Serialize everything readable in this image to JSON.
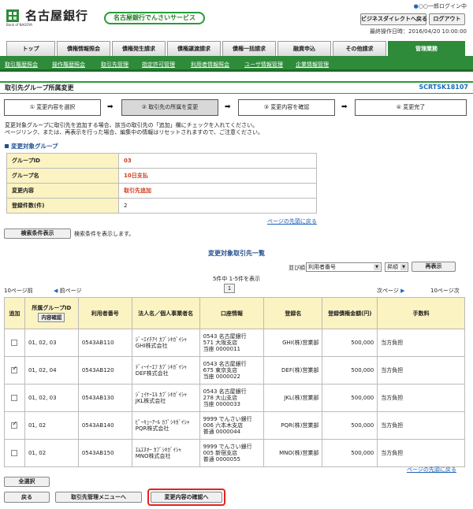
{
  "header": {
    "bank_name": "名古屋銀行",
    "bank_en": "Bank of NAGOYA",
    "service_badge": "名古屋銀行でんさいサービス",
    "user_name": "○○一郎ログイン中",
    "last_login": "最終操作日時：2016/04/20 10:00:00",
    "business_direct_button": "ビジネスダイレクトへ戻る",
    "logout_button": "ログアウト"
  },
  "tabs": [
    {
      "label": "トップ",
      "active": false
    },
    {
      "label": "債権情報照会",
      "active": false
    },
    {
      "label": "債権発生請求",
      "active": false
    },
    {
      "label": "債権譲渡請求",
      "active": false
    },
    {
      "label": "債権一括請求",
      "active": false
    },
    {
      "label": "融資申込",
      "active": false
    },
    {
      "label": "その他請求",
      "active": false
    },
    {
      "label": "管理業務",
      "active": true
    }
  ],
  "subnav": [
    "取引履歴照会",
    "操作履歴照会",
    "取引先管理",
    "指定許可管理",
    "利用者情報照会",
    "ユーザ情報管理",
    "企業情報管理"
  ],
  "page": {
    "title": "取引先グループ所属変更",
    "code": "SCRTSK18107"
  },
  "steps": [
    {
      "label": "① 変更内容を選択",
      "active": false
    },
    {
      "label": "② 取引先の所属を変更",
      "active": true
    },
    {
      "label": "③ 変更内容を確認",
      "active": false
    },
    {
      "label": "④ 変更完了",
      "active": false
    }
  ],
  "description": [
    "変更対象グループに取引先を追加する場合、該当の取引先の「追加」欄にチェックを入れてください。",
    "ページリンク、または、再表示を行った場合、編集中の情報はリセットされますので、ご注意ください。"
  ],
  "group_section": {
    "title": "変更対象グループ",
    "rows": [
      {
        "key": "グループID",
        "value": "03",
        "red": true
      },
      {
        "key": "グループ名",
        "value": "10日支払",
        "red": true
      },
      {
        "key": "変更内容",
        "value": "取引先追加",
        "red": true
      },
      {
        "key": "登録件数(件)",
        "value": "2",
        "red": false
      }
    ]
  },
  "page_top_link": "ページの先頭に戻る",
  "search": {
    "button": "検索条件表示",
    "text": "検索条件を表示します。"
  },
  "list": {
    "title": "変更対象取引先一覧",
    "sort_label": "並び順:",
    "sort_value": "利用者番号",
    "order_value": "昇順",
    "redisplay_button": "再表示",
    "count_text": "5件中 1-5件を表示",
    "page_number": "1",
    "prev10": "10ページ前",
    "prev": "前ページ",
    "next": "次ページ",
    "next10": "10ページ次",
    "headers": {
      "add": "追加",
      "group_id": "所属グループID",
      "content_confirm": "内容確認",
      "user_no": "利用者番号",
      "corp_name": "法人名／個人事業者名",
      "account": "口座情報",
      "reg_name": "登録名",
      "limit": "登録債権金額(円)",
      "fee": "手数料"
    },
    "rows": [
      {
        "checked": false,
        "group_ids": "01, 02, 03",
        "user_no": "0543AB110",
        "kana": "ｼﾞｰｴｲﾁｱｲ ｶﾌﾞｼｷｶﾞｲｼｬ",
        "name": "GHI株式会社",
        "acc1": "0543 名古屋銀行",
        "acc2": "571 大阪支店",
        "acc3": "当座 0000011",
        "reg": "GHI(株)営業部",
        "limit": "500,000",
        "fee": "当方負担"
      },
      {
        "checked": true,
        "group_ids": "01, 02, 04",
        "user_no": "0543AB120",
        "kana": "ﾃﾞｨｰｲｰｴﾌ ｶﾌﾞｼｷｶﾞｲｼｬ",
        "name": "DEF株式会社",
        "acc1": "0543 名古屋銀行",
        "acc2": "675 東京支店",
        "acc3": "当座 0000022",
        "reg": "DEF(株)営業部",
        "limit": "500,000",
        "fee": "当方負担"
      },
      {
        "checked": false,
        "group_ids": "01, 02, 03",
        "user_no": "0543AB130",
        "kana": "ｼﾞｪｲｹｰｴﾙ ｶﾌﾞｼｷｶﾞｲｼｬ",
        "name": "JKL株式会社",
        "acc1": "0543 名古屋銀行",
        "acc2": "278 大山支店",
        "acc3": "当座 0000033",
        "reg": "JKL(株)営業部",
        "limit": "500,000",
        "fee": "当方負担"
      },
      {
        "checked": true,
        "group_ids": "01, 02",
        "user_no": "0543AB140",
        "kana": "ﾋﾟｰｷｭｰｱｰﾙ ｶﾌﾞｼｷｶﾞｲｼｬ",
        "name": "PQR株式会社",
        "acc1": "9999 でんさい銀行",
        "acc2": "006 六本木支店",
        "acc3": "普通 0000044",
        "reg": "PQR(株)営業部",
        "limit": "500,000",
        "fee": "当方負担"
      },
      {
        "checked": false,
        "group_ids": "01, 02",
        "user_no": "0543AB150",
        "kana": "ｴﾑｴﾇｵｰ ｶﾌﾞｼｷｶﾞｲｼｬ",
        "name": "MNO株式会社",
        "acc1": "9999 でんさい銀行",
        "acc2": "005 新宿支店",
        "acc3": "普通 0000055",
        "reg": "MNO(株)営業部",
        "limit": "500,000",
        "fee": "当方負担"
      }
    ]
  },
  "footer": {
    "select_all": "全選択",
    "back": "戻る",
    "menu": "取引先管理メニューへ",
    "confirm": "変更内容の確認へ"
  },
  "colors": {
    "brand_green": "#2e8b3a",
    "header_bg": "#fbf3c2",
    "highlight": "#e82020"
  }
}
